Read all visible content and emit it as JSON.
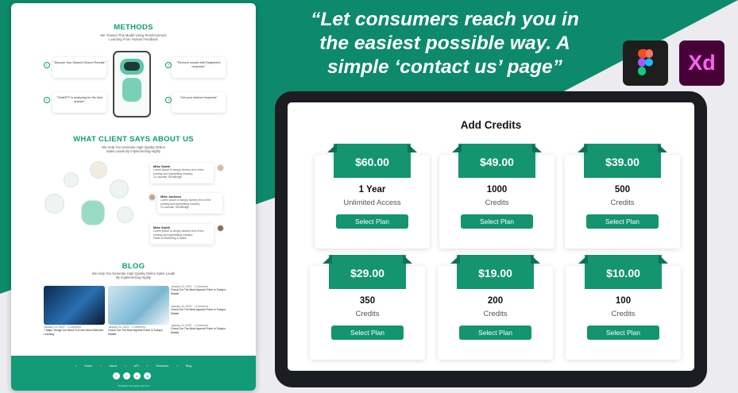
{
  "website": {
    "methods": {
      "title": "METHODS",
      "subtitle": "We Trained This Model Using Reinforcement Learning From Human Feedback",
      "steps": [
        {
          "num": "1",
          "text": "\"Discuss Your Desired Search Results\""
        },
        {
          "num": "2",
          "text": "\"ChatGPT is analyzing for the best answer\""
        },
        {
          "num": "3",
          "text": "\"Remove results with Registered response\""
        },
        {
          "num": "4",
          "text": "\"Get your desired response\""
        }
      ]
    },
    "clients": {
      "title": "WHAT CLIENT SAYS ABOUT US",
      "subtitle": "We Help You Generate High Quality Online Sales Leads By Implementing Highly",
      "reviews": [
        {
          "name": "Mike Smith",
          "text": "Lorem ipsum is simply dummy text of the printing and typesetting industry",
          "role": "Co-founder TechBridge"
        },
        {
          "name": "Mike Jackson",
          "text": "Lorem ipsum is simply dummy text of the printing and typesetting industry",
          "role": "Co-founder TechBridge"
        },
        {
          "name": "Mike Smith",
          "text": "Lorem ipsum is simply dummy text of the printing and typesetting industry",
          "role": "Head of Marketing & Sales"
        }
      ]
    },
    "blog": {
      "title": "BLOG",
      "subtitle": "We Help You Generate High Quality Online Sales Leads By Implementing Highly",
      "posts": [
        {
          "date": "January 24, 2023",
          "comment": "1 Comment",
          "title": "7 Major Things You Need To Know About Machine Learning"
        },
        {
          "date": "January 24, 2023",
          "comment": "1 Comment",
          "title": "Check Out The Best Aspects Prime in Today's Market"
        }
      ],
      "side_posts": [
        {
          "date": "January 24, 2023",
          "comment": "1 Comment",
          "title": "Check Out The Best Aspects Prime in Today's Market"
        },
        {
          "date": "January 24, 2023",
          "comment": "1 Comment",
          "title": "Check Out The Best Aspects Prime in Today's Market"
        },
        {
          "date": "January 24, 2023",
          "comment": "1 Comment",
          "title": "Check Out The Best Aspects Prime in Today's Market"
        }
      ]
    },
    "footer": {
      "nav": "• Home   • About   • API   • Research   • Blog",
      "social": [
        "f",
        "t",
        "in",
        "ig"
      ],
      "copyright": "©ChatGPT All rights reserved"
    }
  },
  "quote": {
    "line1": "“Let consumers reach you in",
    "line2": "the easiest possible way. A",
    "line3": "simple ‘contact us’ page”"
  },
  "apps": {
    "figma_icon": "figma-logo-icon",
    "xd_label": "Xd"
  },
  "tablet": {
    "title": "Add Credits",
    "plans": [
      {
        "price": "$60.00",
        "head": "1 Year",
        "sub": "Unlimited Access",
        "button": "Select Plan"
      },
      {
        "price": "$49.00",
        "head": "1000",
        "sub": "Credits",
        "button": "Select Plan"
      },
      {
        "price": "$39.00",
        "head": "500",
        "sub": "Credits",
        "button": "Select Plan"
      },
      {
        "price": "$29.00",
        "head": "350",
        "sub": "Credits",
        "button": "Select Plan"
      },
      {
        "price": "$19.00",
        "head": "200",
        "sub": "Credits",
        "button": "Select Plan"
      },
      {
        "price": "$10.00",
        "head": "100",
        "sub": "Credits",
        "button": "Select Plan"
      }
    ]
  },
  "colors": {
    "brand_green": "#139a76",
    "ribbon_green": "#14956f",
    "background_teal": "#0d8a6b"
  }
}
